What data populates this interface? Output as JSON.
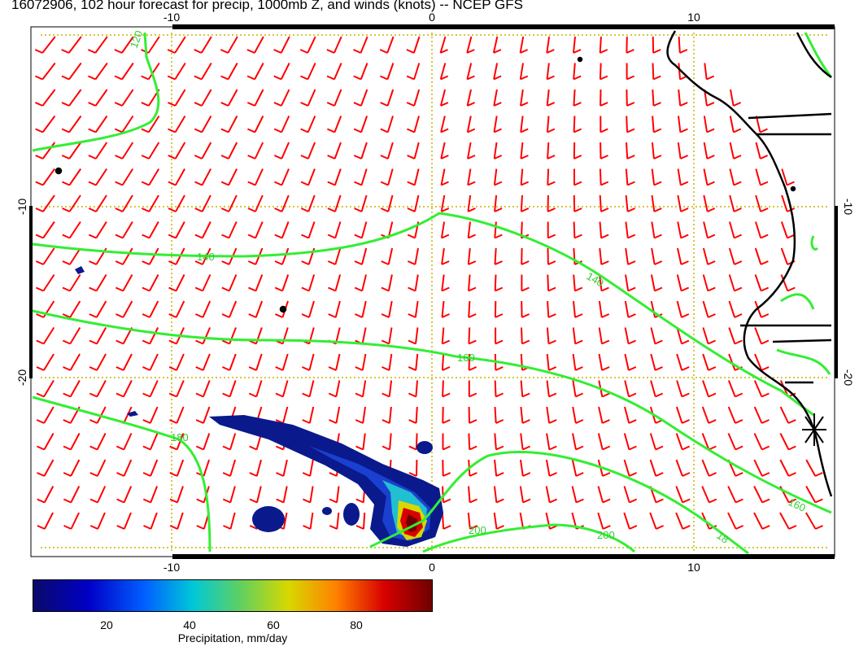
{
  "title": "16072906, 102 hour forecast for precip, 1000mb Z, and winds (knots) -- NCEP GFS",
  "map": {
    "lon_ticks": [
      "-10",
      "0",
      "10"
    ],
    "lat_ticks": [
      "-10",
      "-20"
    ],
    "contour_labels": {
      "c120_top": "120",
      "c140_left": "140",
      "c140_right": "140",
      "c160": "160",
      "c180": "180",
      "c200_a": "200",
      "c200_b": "200",
      "c160_right": "160",
      "c180_right": "18"
    },
    "colors": {
      "contour": "#33ee33",
      "wind_barb": "#ff0000",
      "grid": "#c8b400",
      "coast": "#000000"
    }
  },
  "colorbar": {
    "ticks": [
      "20",
      "40",
      "60",
      "80"
    ],
    "label": "Precipitation, mm/day"
  }
}
